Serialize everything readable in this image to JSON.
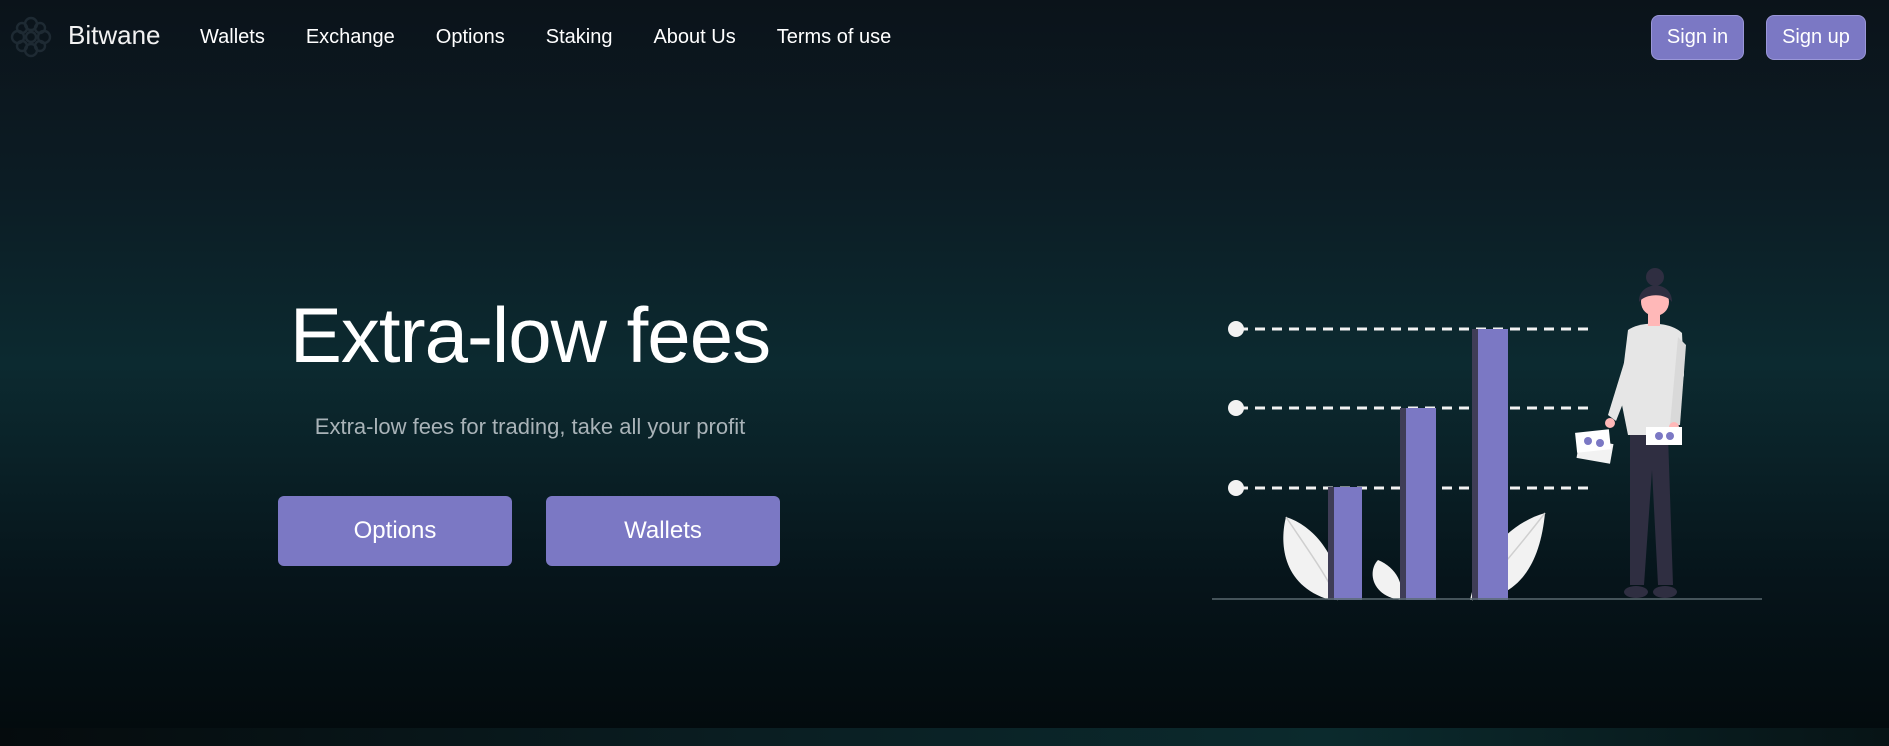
{
  "brand": {
    "name": "Bitwane",
    "logo_icon": "lattice-logo-icon"
  },
  "nav": {
    "links": [
      "Wallets",
      "Exchange",
      "Options",
      "Staking",
      "About Us",
      "Terms of use"
    ],
    "sign_in": "Sign in",
    "sign_up": "Sign up"
  },
  "hero": {
    "title": "Extra-low fees",
    "subtitle": "Extra-low fees for trading, take all your profit",
    "buttons": {
      "options": "Options",
      "wallets": "Wallets"
    }
  },
  "colors": {
    "accent": "#7b78c4",
    "text": "#ffffff",
    "muted_text": "#a9b3b8",
    "background_top": "#0b131a",
    "background_mid": "#0c2a30"
  },
  "illustration": {
    "subject": "person standing beside rising bar chart holding cash",
    "bar_levels": [
      1,
      2,
      3
    ]
  }
}
